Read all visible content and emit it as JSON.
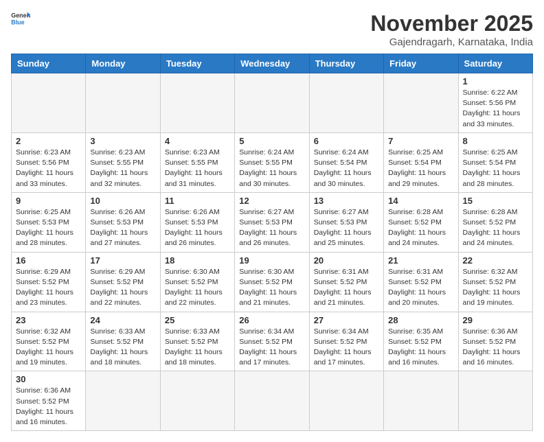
{
  "header": {
    "logo_general": "General",
    "logo_blue": "Blue",
    "month_title": "November 2025",
    "subtitle": "Gajendragarh, Karnataka, India"
  },
  "weekdays": [
    "Sunday",
    "Monday",
    "Tuesday",
    "Wednesday",
    "Thursday",
    "Friday",
    "Saturday"
  ],
  "weeks": [
    [
      {
        "day": "",
        "sunrise": "",
        "sunset": "",
        "daylight": ""
      },
      {
        "day": "",
        "sunrise": "",
        "sunset": "",
        "daylight": ""
      },
      {
        "day": "",
        "sunrise": "",
        "sunset": "",
        "daylight": ""
      },
      {
        "day": "",
        "sunrise": "",
        "sunset": "",
        "daylight": ""
      },
      {
        "day": "",
        "sunrise": "",
        "sunset": "",
        "daylight": ""
      },
      {
        "day": "",
        "sunrise": "",
        "sunset": "",
        "daylight": ""
      },
      {
        "day": "1",
        "sunrise": "Sunrise: 6:22 AM",
        "sunset": "Sunset: 5:56 PM",
        "daylight": "Daylight: 11 hours and 33 minutes."
      }
    ],
    [
      {
        "day": "2",
        "sunrise": "Sunrise: 6:23 AM",
        "sunset": "Sunset: 5:56 PM",
        "daylight": "Daylight: 11 hours and 33 minutes."
      },
      {
        "day": "3",
        "sunrise": "Sunrise: 6:23 AM",
        "sunset": "Sunset: 5:55 PM",
        "daylight": "Daylight: 11 hours and 32 minutes."
      },
      {
        "day": "4",
        "sunrise": "Sunrise: 6:23 AM",
        "sunset": "Sunset: 5:55 PM",
        "daylight": "Daylight: 11 hours and 31 minutes."
      },
      {
        "day": "5",
        "sunrise": "Sunrise: 6:24 AM",
        "sunset": "Sunset: 5:55 PM",
        "daylight": "Daylight: 11 hours and 30 minutes."
      },
      {
        "day": "6",
        "sunrise": "Sunrise: 6:24 AM",
        "sunset": "Sunset: 5:54 PM",
        "daylight": "Daylight: 11 hours and 30 minutes."
      },
      {
        "day": "7",
        "sunrise": "Sunrise: 6:25 AM",
        "sunset": "Sunset: 5:54 PM",
        "daylight": "Daylight: 11 hours and 29 minutes."
      },
      {
        "day": "8",
        "sunrise": "Sunrise: 6:25 AM",
        "sunset": "Sunset: 5:54 PM",
        "daylight": "Daylight: 11 hours and 28 minutes."
      }
    ],
    [
      {
        "day": "9",
        "sunrise": "Sunrise: 6:25 AM",
        "sunset": "Sunset: 5:53 PM",
        "daylight": "Daylight: 11 hours and 28 minutes."
      },
      {
        "day": "10",
        "sunrise": "Sunrise: 6:26 AM",
        "sunset": "Sunset: 5:53 PM",
        "daylight": "Daylight: 11 hours and 27 minutes."
      },
      {
        "day": "11",
        "sunrise": "Sunrise: 6:26 AM",
        "sunset": "Sunset: 5:53 PM",
        "daylight": "Daylight: 11 hours and 26 minutes."
      },
      {
        "day": "12",
        "sunrise": "Sunrise: 6:27 AM",
        "sunset": "Sunset: 5:53 PM",
        "daylight": "Daylight: 11 hours and 26 minutes."
      },
      {
        "day": "13",
        "sunrise": "Sunrise: 6:27 AM",
        "sunset": "Sunset: 5:53 PM",
        "daylight": "Daylight: 11 hours and 25 minutes."
      },
      {
        "day": "14",
        "sunrise": "Sunrise: 6:28 AM",
        "sunset": "Sunset: 5:52 PM",
        "daylight": "Daylight: 11 hours and 24 minutes."
      },
      {
        "day": "15",
        "sunrise": "Sunrise: 6:28 AM",
        "sunset": "Sunset: 5:52 PM",
        "daylight": "Daylight: 11 hours and 24 minutes."
      }
    ],
    [
      {
        "day": "16",
        "sunrise": "Sunrise: 6:29 AM",
        "sunset": "Sunset: 5:52 PM",
        "daylight": "Daylight: 11 hours and 23 minutes."
      },
      {
        "day": "17",
        "sunrise": "Sunrise: 6:29 AM",
        "sunset": "Sunset: 5:52 PM",
        "daylight": "Daylight: 11 hours and 22 minutes."
      },
      {
        "day": "18",
        "sunrise": "Sunrise: 6:30 AM",
        "sunset": "Sunset: 5:52 PM",
        "daylight": "Daylight: 11 hours and 22 minutes."
      },
      {
        "day": "19",
        "sunrise": "Sunrise: 6:30 AM",
        "sunset": "Sunset: 5:52 PM",
        "daylight": "Daylight: 11 hours and 21 minutes."
      },
      {
        "day": "20",
        "sunrise": "Sunrise: 6:31 AM",
        "sunset": "Sunset: 5:52 PM",
        "daylight": "Daylight: 11 hours and 21 minutes."
      },
      {
        "day": "21",
        "sunrise": "Sunrise: 6:31 AM",
        "sunset": "Sunset: 5:52 PM",
        "daylight": "Daylight: 11 hours and 20 minutes."
      },
      {
        "day": "22",
        "sunrise": "Sunrise: 6:32 AM",
        "sunset": "Sunset: 5:52 PM",
        "daylight": "Daylight: 11 hours and 19 minutes."
      }
    ],
    [
      {
        "day": "23",
        "sunrise": "Sunrise: 6:32 AM",
        "sunset": "Sunset: 5:52 PM",
        "daylight": "Daylight: 11 hours and 19 minutes."
      },
      {
        "day": "24",
        "sunrise": "Sunrise: 6:33 AM",
        "sunset": "Sunset: 5:52 PM",
        "daylight": "Daylight: 11 hours and 18 minutes."
      },
      {
        "day": "25",
        "sunrise": "Sunrise: 6:33 AM",
        "sunset": "Sunset: 5:52 PM",
        "daylight": "Daylight: 11 hours and 18 minutes."
      },
      {
        "day": "26",
        "sunrise": "Sunrise: 6:34 AM",
        "sunset": "Sunset: 5:52 PM",
        "daylight": "Daylight: 11 hours and 17 minutes."
      },
      {
        "day": "27",
        "sunrise": "Sunrise: 6:34 AM",
        "sunset": "Sunset: 5:52 PM",
        "daylight": "Daylight: 11 hours and 17 minutes."
      },
      {
        "day": "28",
        "sunrise": "Sunrise: 6:35 AM",
        "sunset": "Sunset: 5:52 PM",
        "daylight": "Daylight: 11 hours and 16 minutes."
      },
      {
        "day": "29",
        "sunrise": "Sunrise: 6:36 AM",
        "sunset": "Sunset: 5:52 PM",
        "daylight": "Daylight: 11 hours and 16 minutes."
      }
    ],
    [
      {
        "day": "30",
        "sunrise": "Sunrise: 6:36 AM",
        "sunset": "Sunset: 5:52 PM",
        "daylight": "Daylight: 11 hours and 16 minutes."
      },
      {
        "day": "",
        "sunrise": "",
        "sunset": "",
        "daylight": ""
      },
      {
        "day": "",
        "sunrise": "",
        "sunset": "",
        "daylight": ""
      },
      {
        "day": "",
        "sunrise": "",
        "sunset": "",
        "daylight": ""
      },
      {
        "day": "",
        "sunrise": "",
        "sunset": "",
        "daylight": ""
      },
      {
        "day": "",
        "sunrise": "",
        "sunset": "",
        "daylight": ""
      },
      {
        "day": "",
        "sunrise": "",
        "sunset": "",
        "daylight": ""
      }
    ]
  ]
}
